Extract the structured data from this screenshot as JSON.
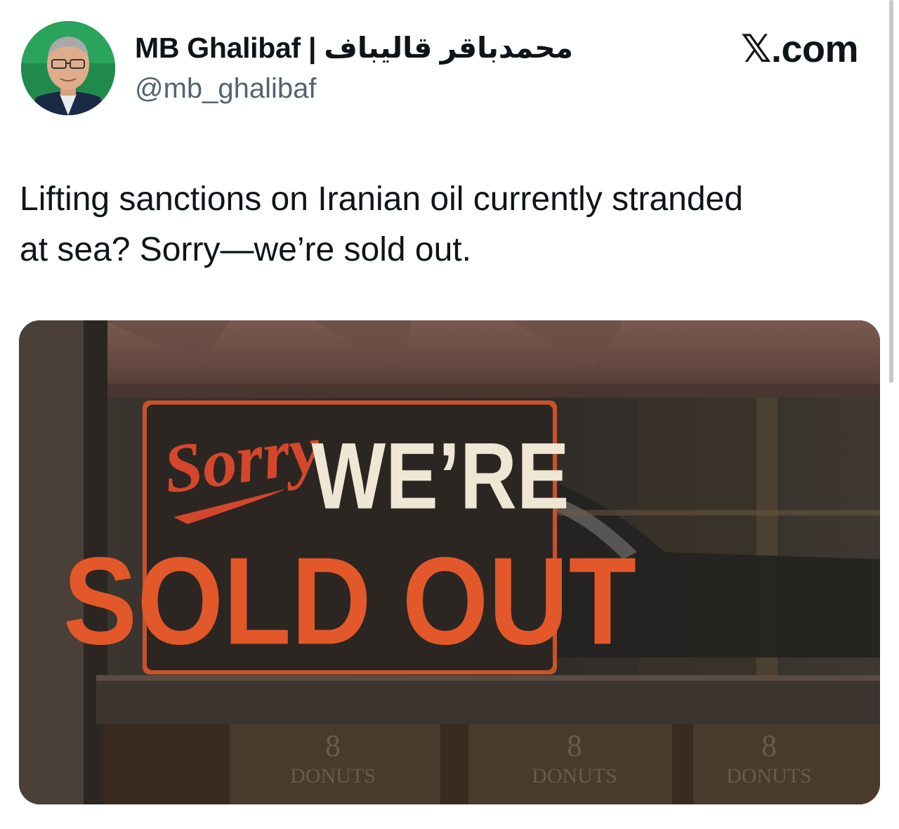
{
  "author": {
    "name": "MB Ghalibaf | محمدباقر قالیباف",
    "handle": "@mb_ghalibaf"
  },
  "source": "𝕏.com",
  "tweet": {
    "lines": [
      "Lifting sanctions on Iranian oil currently stranded",
      "at sea? Sorry—we’re sold out."
    ]
  },
  "media": {
    "sign": {
      "script": "Sorry",
      "top": "WE’RE",
      "bottom": "SOLD OUT"
    },
    "boxes": [
      "DONUTS",
      "DONUTS",
      "DONUTS"
    ],
    "box_logo": "8"
  },
  "colors": {
    "text": "#0f1419",
    "secondary": "#536471",
    "sign_orange": "#e2582a",
    "sign_dark": "#2b2622",
    "sign_cream": "#efe6d4"
  }
}
